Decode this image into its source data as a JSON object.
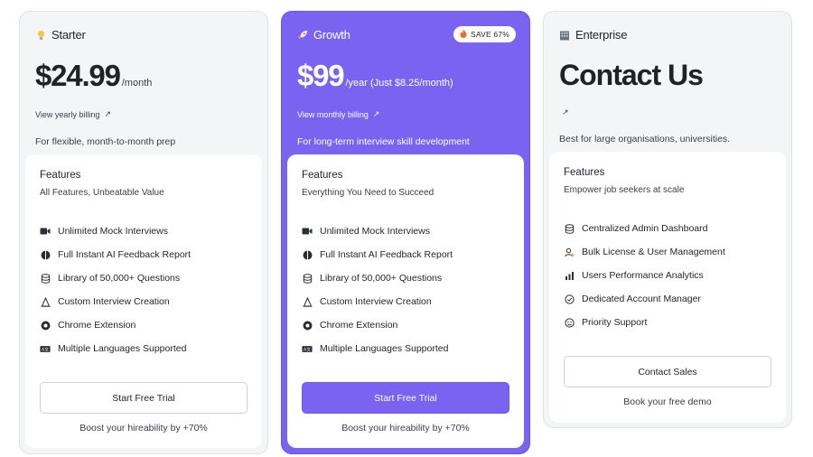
{
  "plans": [
    {
      "name": "Starter",
      "icon": "lightbulb-icon",
      "price": "$24.99",
      "period": "/month",
      "billing_link": "View yearly billing",
      "billing_arrow": "↗",
      "description": "For flexible, month-to-month prep",
      "features_title": "Features",
      "features_subtitle": "All Features, Unbeatable Value",
      "features": [
        {
          "label": "Unlimited Mock Interviews",
          "icon": "video-camera-icon"
        },
        {
          "label": "Full Instant AI Feedback Report",
          "icon": "brain-icon"
        },
        {
          "label": "Library of 50,000+ Questions",
          "icon": "database-icon"
        },
        {
          "label": "Custom Interview Creation",
          "icon": "construction-icon"
        },
        {
          "label": "Chrome Extension",
          "icon": "chrome-icon"
        },
        {
          "label": "Multiple Languages Supported",
          "icon": "language-icon"
        }
      ],
      "cta": "Start Free Trial",
      "cta_note": "Boost your hireability by +70%"
    },
    {
      "name": "Growth",
      "icon": "rocket-icon",
      "badge": "SAVE 67%",
      "badge_icon": "fire-icon",
      "price": "$99",
      "period": "/year (Just $8.25/month)",
      "billing_link": "View monthly billing",
      "billing_arrow": "↗",
      "description": "For long-term interview skill development",
      "features_title": "Features",
      "features_subtitle": "Everything You Need to Succeed",
      "features": [
        {
          "label": "Unlimited Mock Interviews",
          "icon": "video-camera-icon"
        },
        {
          "label": "Full Instant AI Feedback Report",
          "icon": "brain-icon"
        },
        {
          "label": "Library of 50,000+ Questions",
          "icon": "database-icon"
        },
        {
          "label": "Custom Interview Creation",
          "icon": "construction-icon"
        },
        {
          "label": "Chrome Extension",
          "icon": "chrome-icon"
        },
        {
          "label": "Multiple Languages Supported",
          "icon": "language-icon"
        }
      ],
      "cta": "Start Free Trial",
      "cta_note": "Boost your hireability by +70%"
    },
    {
      "name": "Enterprise",
      "icon": "building-icon",
      "title": "Contact Us",
      "billing_arrow": "↗",
      "description": "Best for large organisations, universities.",
      "features_title": "Features",
      "features_subtitle": "Empower job seekers at scale",
      "features": [
        {
          "label": "Centralized Admin Dashboard",
          "icon": "database-icon"
        },
        {
          "label": "Bulk License & User Management",
          "icon": "users-icon"
        },
        {
          "label": "Users Performance Analytics",
          "icon": "bar-chart-icon"
        },
        {
          "label": "Dedicated Account Manager",
          "icon": "account-manager-icon"
        },
        {
          "label": "Priority Support",
          "icon": "support-icon"
        }
      ],
      "cta": "Contact Sales",
      "cta_note": "Book your free demo"
    }
  ],
  "colors": {
    "accent": "#7a63f1",
    "card_bg": "#f4f5f7",
    "text": "#1f2328"
  }
}
